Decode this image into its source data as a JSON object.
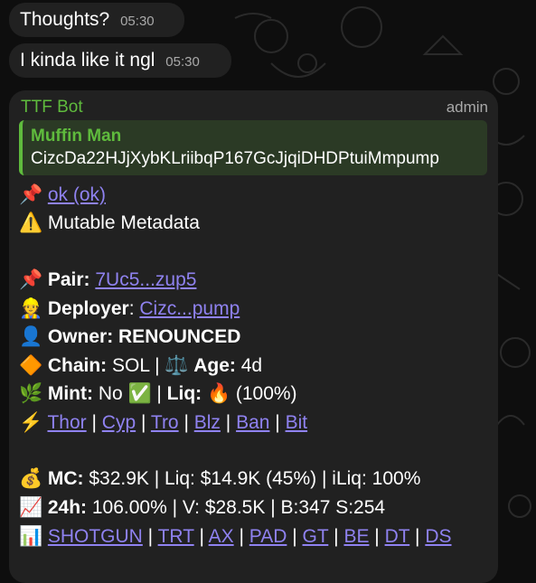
{
  "messages": [
    {
      "text": "Thoughts?",
      "time": "05:30"
    },
    {
      "text": "I kinda like it ngl",
      "time": "05:30"
    }
  ],
  "bot": {
    "sender": "TTF Bot",
    "role": "admin",
    "quote_title": "Muffin Man",
    "quote_text": "CizcDa22HJjXybKLriibqP167GcJjqiDHDPtuiMmpump",
    "ok_link": "ok (ok)",
    "mutable": "Mutable Metadata",
    "pair_label": "Pair:",
    "pair_value": "7Uc5...zup5",
    "deployer_label": "Deployer",
    "deployer_value": "Cizc...pump",
    "owner": "Owner: RENOUNCED",
    "chain_label": "Chain:",
    "chain_value": "SOL",
    "age_label": "Age:",
    "age_value": "4d",
    "mint_label": "Mint:",
    "mint_value": "No",
    "liq_label": "Liq:",
    "liq_value": "(100%)",
    "links1": [
      "Thor",
      "Cyp",
      "Tro",
      "Blz",
      "Ban",
      "Bit"
    ],
    "mc_label": "MC:",
    "mc_value": "$32.9K",
    "mc_liq_label": "Liq:",
    "mc_liq_value": "$14.9K (45%)",
    "iliq_label": "iLiq:",
    "iliq_value": "100%",
    "h24_label": "24h:",
    "h24_value": "106.00%",
    "v_label": "V:",
    "v_value": "$28.5K",
    "bs_label": "B:347 S:254",
    "links2": [
      "SHOTGUN",
      "TRT",
      "AX",
      "PAD",
      "GT",
      "BE",
      "DT",
      "DS"
    ]
  },
  "icons": {
    "pin": "pushpin-icon",
    "warning": "warning-icon",
    "deployer": "deployer-icon",
    "owner": "owner-icon",
    "chain": "diamond-icon",
    "scale": "scale-icon",
    "mint": "herb-icon",
    "check": "check-icon",
    "fire": "fire-icon",
    "bolt": "lightning-icon",
    "money": "moneybag-icon",
    "chart": "chart-up-icon",
    "bars": "bar-chart-icon"
  },
  "colors": {
    "bg": "#0e0e0e",
    "bubble": "#212121",
    "green": "#5fbb3d",
    "link": "#8f82f0",
    "meta": "#a9a9a9"
  }
}
